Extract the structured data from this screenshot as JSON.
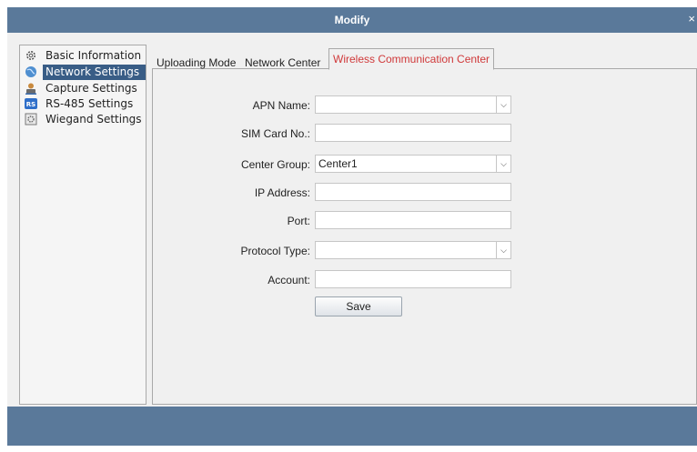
{
  "window": {
    "title": "Modify",
    "close_glyph": "×"
  },
  "sidebar": {
    "items": [
      {
        "label": "Basic Information",
        "icon": "gear-icon"
      },
      {
        "label": "Network Settings",
        "icon": "globe-icon"
      },
      {
        "label": "Capture Settings",
        "icon": "camera-person-icon"
      },
      {
        "label": "RS-485 Settings",
        "icon": "rs-badge-icon"
      },
      {
        "label": "Wiegand Settings",
        "icon": "card-gear-icon"
      }
    ],
    "active_index": 1
  },
  "tabs": [
    {
      "label": "Uploading Mode"
    },
    {
      "label": "Network Center"
    },
    {
      "label": "Wireless Communication Center"
    }
  ],
  "form": {
    "apn_name": {
      "label": "APN Name:",
      "value": ""
    },
    "sim_card": {
      "label": "SIM Card No.:",
      "value": ""
    },
    "center_group": {
      "label": "Center Group:",
      "value": "Center1"
    },
    "ip_address": {
      "label": "IP Address:",
      "value": ""
    },
    "port": {
      "label": "Port:",
      "value": ""
    },
    "protocol_type": {
      "label": "Protocol Type:",
      "value": ""
    },
    "account": {
      "label": "Account:",
      "value": ""
    },
    "save_label": "Save"
  },
  "colors": {
    "titlebar": "#5a799a",
    "active_nav": "#395d86",
    "active_tab_text": "#d0393a"
  }
}
